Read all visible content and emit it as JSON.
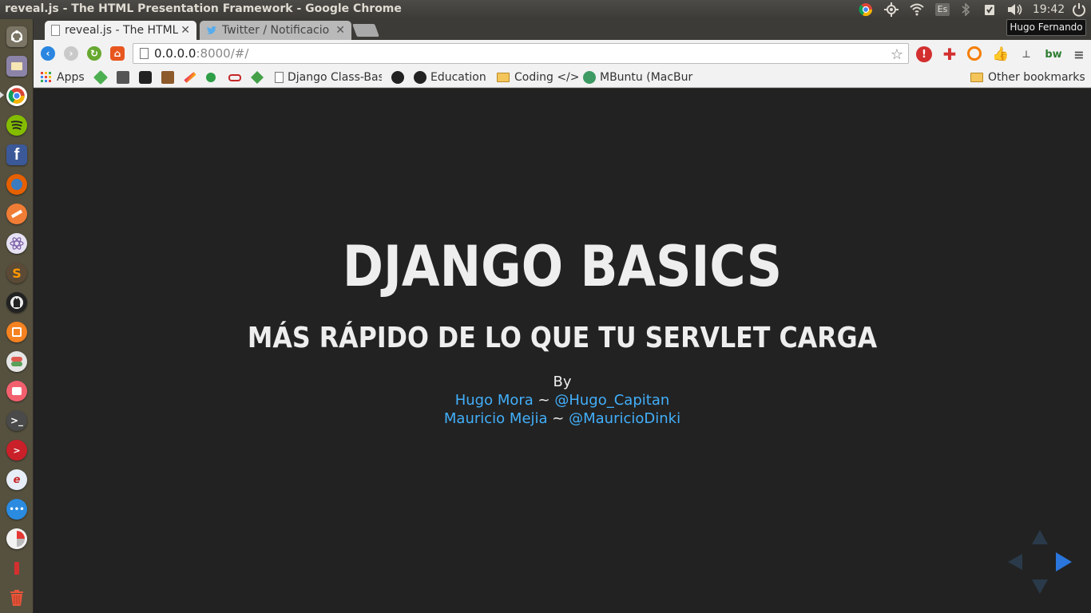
{
  "window": {
    "title": "reveal.js - The HTML Presentation Framework - Google Chrome",
    "user_name": "Hugo Fernando",
    "language": "Es",
    "clock": "19:42"
  },
  "tabs": [
    {
      "label": "reveal.js - The HTML",
      "active": true
    },
    {
      "label": "Twitter / Notificacio",
      "active": false
    }
  ],
  "address_bar": {
    "host": "0.0.0.0",
    "path": ":8000/#/"
  },
  "bookmarks": {
    "apps_label": "Apps",
    "items": [
      {
        "label": "Django Class-Bas"
      },
      {
        "label": "Education"
      },
      {
        "label": "Coding </>"
      },
      {
        "label": "MBuntu (MacBur"
      }
    ],
    "other_label": "Other bookmarks",
    "extension_label": "bw"
  },
  "slide": {
    "title": "DJANGO BASICS",
    "subtitle": "MÁS RÁPIDO DE LO QUE TU SERVLET CARGA",
    "by": "By",
    "authors": [
      {
        "name": "Hugo Mora",
        "separator": "~",
        "handle": "@Hugo_Capitan"
      },
      {
        "name": "Mauricio Mejia",
        "separator": "~",
        "handle": "@MauricioDinki"
      }
    ]
  },
  "colors": {
    "slide_background": "#222222",
    "link": "#42affa",
    "launcher": "#56513f"
  },
  "launcher_icons": [
    "dash-icon",
    "files-icon",
    "chrome-icon",
    "spotify-icon",
    "facebook-icon",
    "firefox-icon",
    "pencil-app-icon",
    "atom-icon",
    "sublime-icon",
    "github-icon",
    "software-center-icon",
    "settings-icon",
    "app-icon",
    "terminal-icon",
    "remote-icon",
    "editor-icon",
    "messaging-icon",
    "disk-icon",
    "usb-icon",
    "trash-icon"
  ]
}
